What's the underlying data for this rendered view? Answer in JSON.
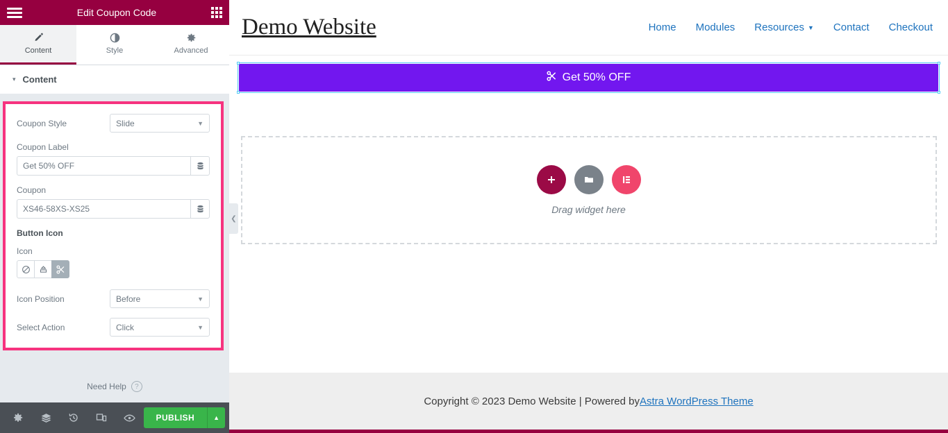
{
  "panel": {
    "header": {
      "title": "Edit Coupon Code",
      "menu_icon": "hamburger-icon",
      "apps_icon": "grid-apps-icon"
    },
    "tabs": [
      {
        "label": "Content",
        "icon": "pencil-icon",
        "active": true
      },
      {
        "label": "Style",
        "icon": "contrast-icon",
        "active": false
      },
      {
        "label": "Advanced",
        "icon": "gear-icon",
        "active": false
      }
    ],
    "section": {
      "label": "Content",
      "caret": "▾"
    },
    "controls": {
      "coupon_style": {
        "label": "Coupon Style",
        "value": "Slide"
      },
      "coupon_label": {
        "label": "Coupon Label",
        "value": "Get 50% OFF",
        "placeholder": "Coupon Label"
      },
      "coupon": {
        "label": "Coupon",
        "value": "XS46-58XS-XS25",
        "placeholder": "Coupon"
      },
      "button_icon_heading": "Button Icon",
      "icon": {
        "label": "Icon",
        "options": [
          {
            "name": "none-icon",
            "selected": false
          },
          {
            "name": "upload-icon",
            "selected": false
          },
          {
            "name": "scissors-icon",
            "selected": true
          }
        ]
      },
      "icon_position": {
        "label": "Icon Position",
        "value": "Before"
      },
      "select_action": {
        "label": "Select Action",
        "value": "Click"
      }
    },
    "need_help": {
      "label": "Need Help",
      "icon": "question-circle-icon"
    },
    "footer": {
      "buttons": [
        {
          "name": "settings-icon"
        },
        {
          "name": "navigator-layers-icon"
        },
        {
          "name": "history-icon"
        },
        {
          "name": "responsive-mode-icon"
        },
        {
          "name": "preview-eye-icon"
        }
      ],
      "publish_label": "PUBLISH",
      "publish_arrow": "▲",
      "publish_color": "#39b54a"
    },
    "collapse_arrow": "❮",
    "highlight_color": "#f6337f",
    "header_color": "#960040"
  },
  "preview": {
    "site_title": "Demo Website",
    "nav": [
      {
        "label": "Home",
        "has_dropdown": false
      },
      {
        "label": "Modules",
        "has_dropdown": false
      },
      {
        "label": "Resources",
        "has_dropdown": true
      },
      {
        "label": "Contact",
        "has_dropdown": false
      },
      {
        "label": "Checkout",
        "has_dropdown": false
      }
    ],
    "nav_chevron": "⌄",
    "banner": {
      "text": "Get 50% OFF",
      "icon": "scissors-icon",
      "background": "#7217ef",
      "selected": true
    },
    "dropzone": {
      "text": "Drag widget here",
      "buttons": [
        {
          "name": "add-section-icon",
          "color": "#9b0a46"
        },
        {
          "name": "folder-template-icon",
          "color": "#7a828a"
        },
        {
          "name": "elementor-logo-icon",
          "color": "#f0456b"
        }
      ]
    },
    "footer": {
      "text_before": "Copyright © 2023 Demo Website | Powered by ",
      "link": "Astra WordPress Theme"
    }
  }
}
